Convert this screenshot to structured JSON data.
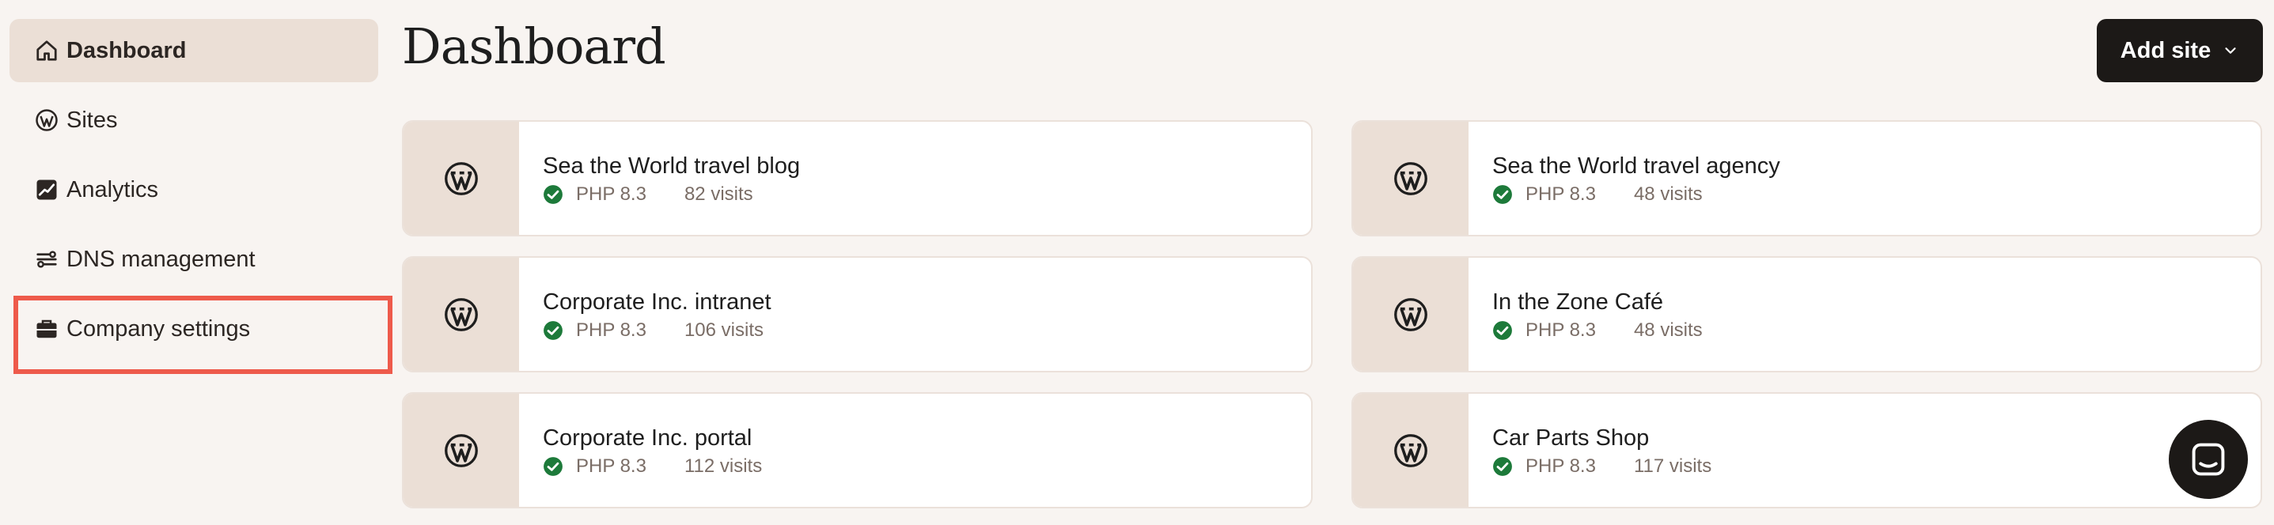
{
  "sidebar": {
    "items": [
      {
        "label": "Dashboard",
        "icon": "home-icon",
        "active": true
      },
      {
        "label": "Sites",
        "icon": "wordpress-icon"
      },
      {
        "label": "Analytics",
        "icon": "chart-icon"
      },
      {
        "label": "DNS management",
        "icon": "dns-icon"
      },
      {
        "label": "Company settings",
        "icon": "briefcase-icon",
        "highlighted": true
      }
    ]
  },
  "header": {
    "title": "Dashboard",
    "add_site_label": "Add site"
  },
  "sites": [
    {
      "name": "Sea the World travel blog",
      "php": "PHP 8.3",
      "visits": "82 visits"
    },
    {
      "name": "Sea the World travel agency",
      "php": "PHP 8.3",
      "visits": "48 visits"
    },
    {
      "name": "Corporate Inc. intranet",
      "php": "PHP 8.3",
      "visits": "106 visits"
    },
    {
      "name": "In the Zone Café",
      "php": "PHP 8.3",
      "visits": "48 visits"
    },
    {
      "name": "Corporate Inc. portal",
      "php": "PHP 8.3",
      "visits": "112 visits"
    },
    {
      "name": "Car Parts Shop",
      "php": "PHP 8.3",
      "visits": "117 visits"
    }
  ],
  "colors": {
    "background": "#f8f4f1",
    "accent_beige": "#ebdfd6",
    "dark": "#1c1917",
    "status_ok": "#1d7a3a",
    "highlight": "#ee5a4b"
  }
}
